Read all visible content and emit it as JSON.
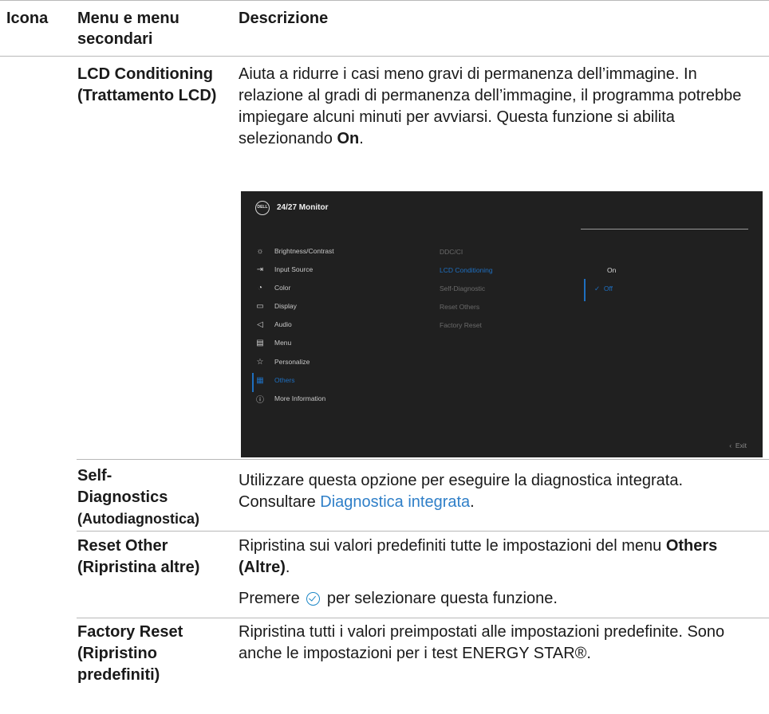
{
  "header": {
    "col_icon": "Icona",
    "col_menu": "Menu e menu secondari",
    "col_desc": "Descrizione"
  },
  "rows": {
    "lcd": {
      "label": "LCD Conditioning (Trattamento LCD)",
      "text": "Aiuta a ridurre i casi meno gravi di permanenza dell’immagine. In relazione al gradi di permanenza dell’immagine, il programma potrebbe impiegare alcuni minuti per avviarsi. Questa funzione si abilita selezionando",
      "bold": "On",
      "tail": "."
    },
    "selfdiag": {
      "label_1": "Self-",
      "label_2": "Diagnostics",
      "label_3": "(Autodiagnostica)",
      "text": "Utilizzare questa opzione per eseguire la diagnostica integrata. Consultare",
      "link": "Diagnostica integrata",
      "tail": "."
    },
    "resetother": {
      "label": "Reset Other (Ripristina altre)",
      "text": "Ripristina sui valori predefiniti tutte le impostazioni del menu",
      "bold": "Others (Altre)",
      "tail": ".",
      "text2_pre": "Premere",
      "text2_post": "per selezionare questa funzione."
    },
    "factory": {
      "label": "Factory Reset (Ripristino predefiniti)",
      "text": "Ripristina tutti i valori preimpostati alle impostazioni predefinite. Sono anche le impostazioni per i test ENERGY STAR®."
    }
  },
  "osd": {
    "logo": "DELL",
    "title": "24/27 Monitor",
    "menu": [
      {
        "label": "Brightness/Contrast",
        "icon": "sun-icon"
      },
      {
        "label": "Input Source",
        "icon": "input-icon"
      },
      {
        "label": "Color",
        "icon": "palette-icon"
      },
      {
        "label": "Display",
        "icon": "display-icon"
      },
      {
        "label": "Audio",
        "icon": "speaker-icon"
      },
      {
        "label": "Menu",
        "icon": "menu-icon"
      },
      {
        "label": "Personalize",
        "icon": "star-icon"
      },
      {
        "label": "Others",
        "icon": "others-icon"
      },
      {
        "label": "More Information",
        "icon": "info-icon"
      }
    ],
    "submenu": [
      "DDC/CI",
      "LCD Conditioning",
      "Self-Diagnostic",
      "Reset Others",
      "Factory Reset"
    ],
    "options": {
      "on": "On",
      "off": "Off"
    },
    "exit": "Exit",
    "accent": "#1e6fc0"
  }
}
